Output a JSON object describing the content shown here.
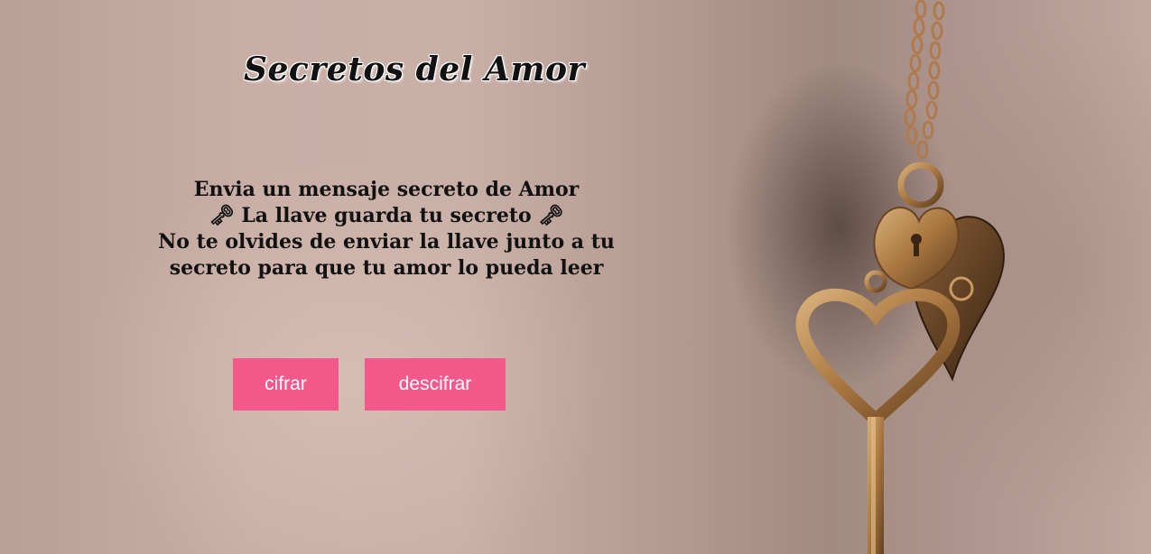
{
  "header": {
    "title": "Secretos del Amor"
  },
  "intro": {
    "line1": "Envia un mensaje secreto de Amor",
    "line2": "🗝 La llave guarda tu secreto 🗝",
    "line3": "No te olvides de enviar la llave junto a tu",
    "line4": "secreto para que tu amor lo pueda leer"
  },
  "actions": {
    "encrypt_label": "cifrar",
    "decrypt_label": "descifrar"
  },
  "colors": {
    "button_bg": "#f5588a",
    "button_text": "#ffffff",
    "text": "#111111"
  },
  "background": {
    "image": "heart-key-necklace-photo"
  }
}
